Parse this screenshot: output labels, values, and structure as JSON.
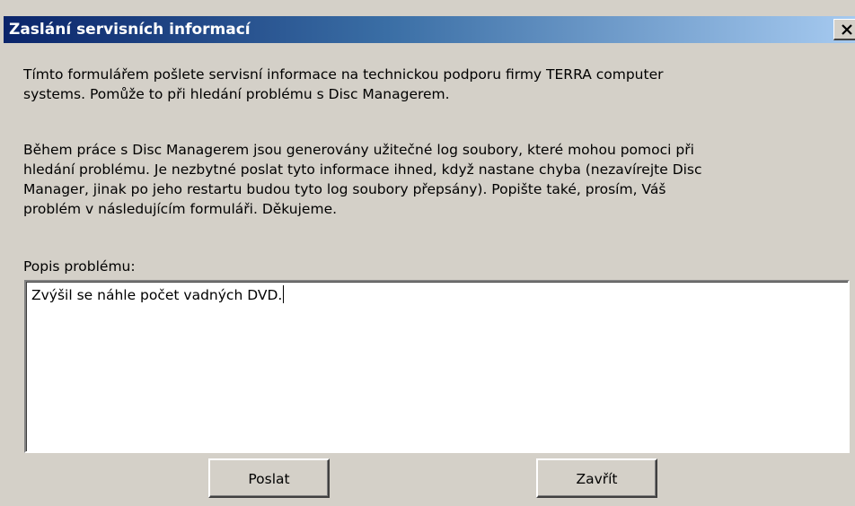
{
  "window": {
    "title": "Zaslání servisních informací",
    "close_icon": "close-icon"
  },
  "intro": {
    "lines": [
      "Tímto formulářem pošlete servisní informace na technickou podporu firmy TERRA computer",
      "systems. Pomůže to při hledání problému s Disc Managerem."
    ]
  },
  "details": {
    "lines": [
      "Během práce s Disc Managerem jsou generovány užitečné log soubory, které mohou pomoci při",
      "hledání problému. Je nezbytné poslat tyto informace ihned, když nastane chyba (nezavírejte Disc",
      "Manager, jinak po jeho restartu budou tyto log soubory přepsány). Popište také, prosím, Váš",
      "problém v následujícím formuláři. Děkujeme."
    ]
  },
  "problem": {
    "label": "Popis problému:",
    "value": "Zvýšil se náhle počet vadných DVD."
  },
  "buttons": {
    "send_label": "Poslat",
    "close_label": "Zavřít"
  },
  "colors": {
    "titlebar_start": "#0a246a",
    "titlebar_end": "#a6caf0",
    "dialog_face": "#d4d0c8",
    "title_text": "#ffffff"
  }
}
